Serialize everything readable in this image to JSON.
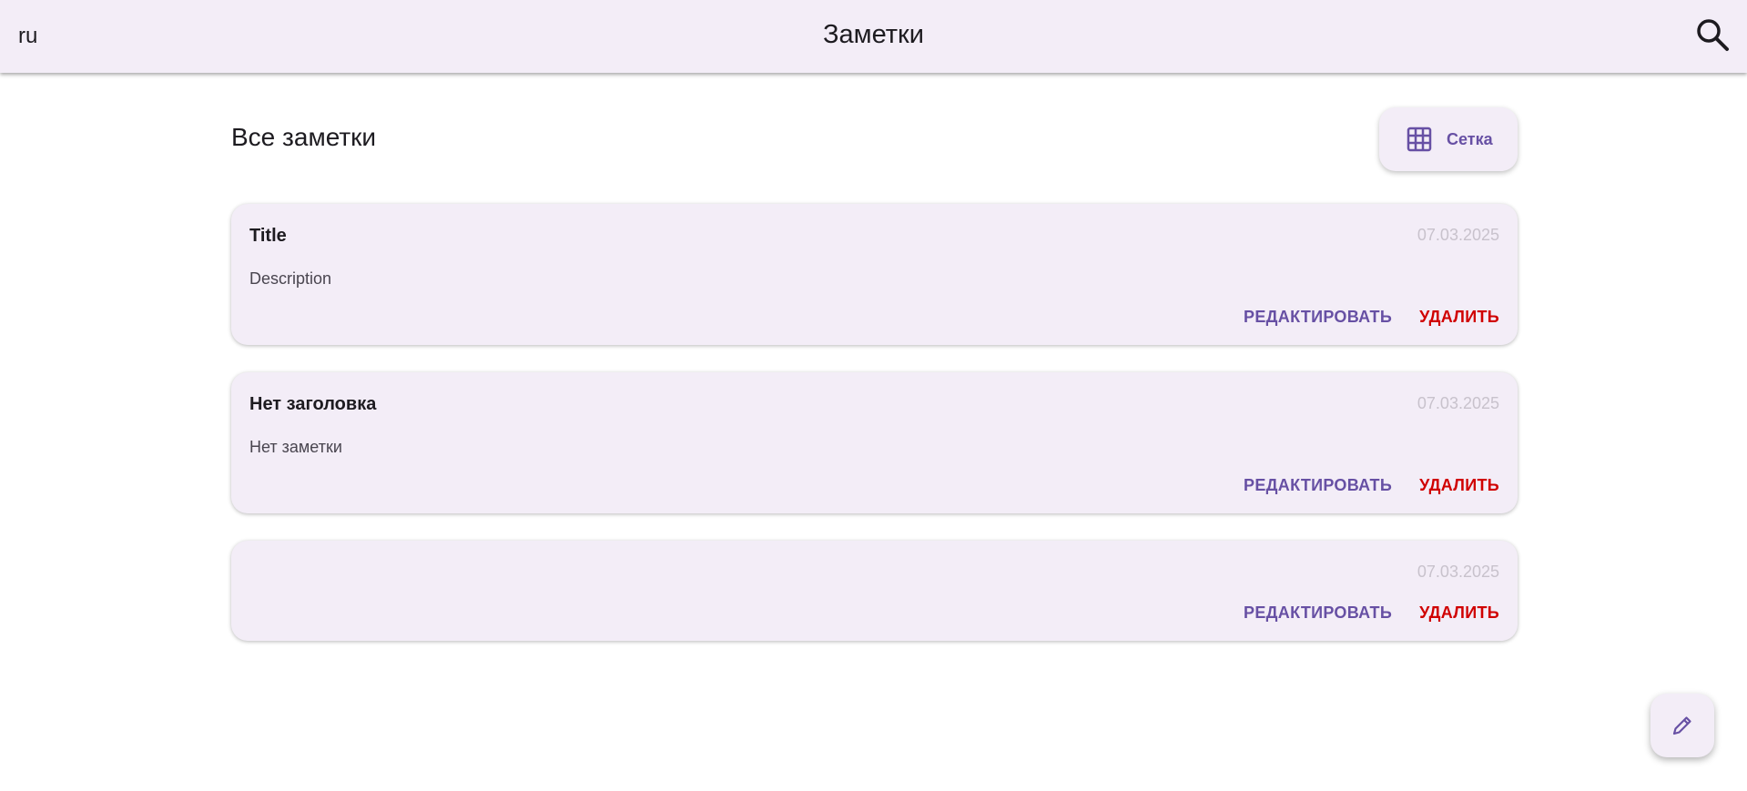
{
  "appbar": {
    "language": "ru",
    "title": "Заметки",
    "search_icon": "search-icon"
  },
  "section": {
    "title": "Все заметки",
    "view_toggle": {
      "icon": "grid-icon",
      "label": "Сетка"
    }
  },
  "notes": [
    {
      "title": "Title",
      "date": "07.03.2025",
      "description": "Description",
      "edit_label": "РЕДАКТИРОВАТЬ",
      "delete_label": "УДАЛИТЬ"
    },
    {
      "title": "Нет заголовка",
      "date": "07.03.2025",
      "description": "Нет заметки",
      "edit_label": "РЕДАКТИРОВАТЬ",
      "delete_label": "УДАЛИТЬ"
    },
    {
      "title": "",
      "date": "07.03.2025",
      "description": "",
      "edit_label": "РЕДАКТИРОВАТЬ",
      "delete_label": "УДАЛИТЬ"
    }
  ],
  "fab": {
    "icon": "pencil-icon"
  },
  "colors": {
    "surface": "#f3edf7",
    "primary": "#6750a4",
    "danger": "#d00000",
    "date": "#c8c2cc"
  }
}
